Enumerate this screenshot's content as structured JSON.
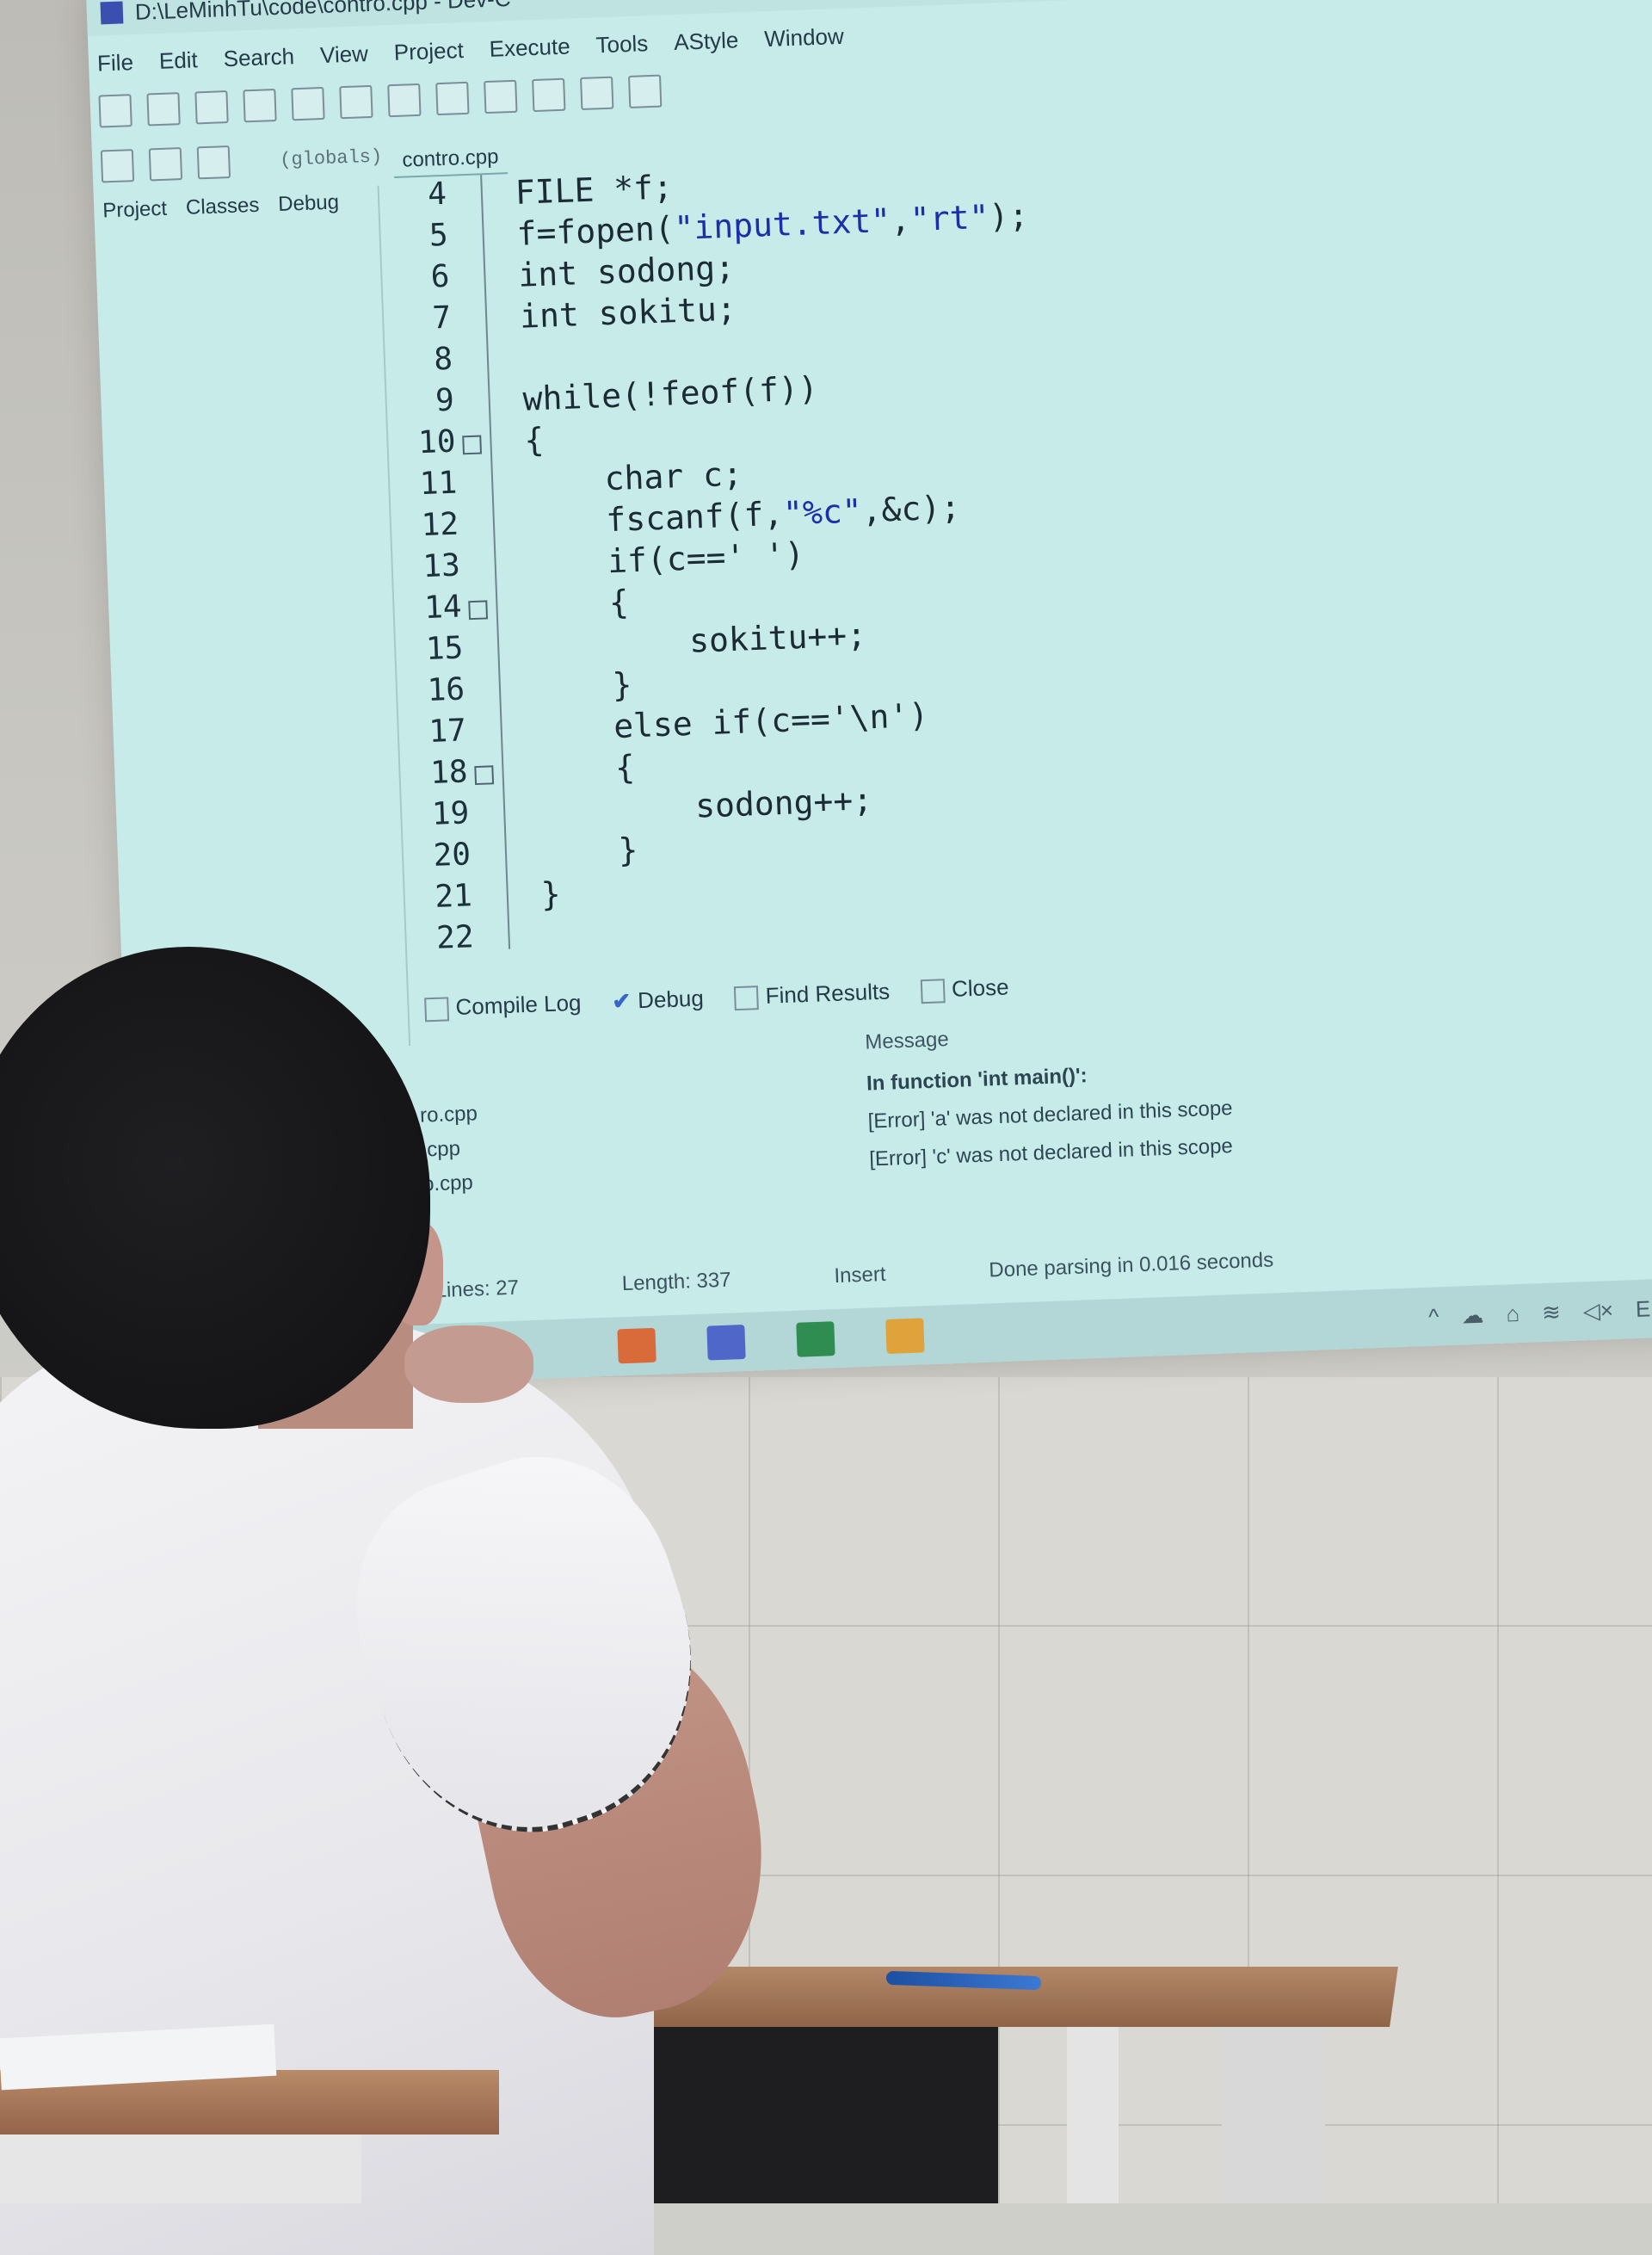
{
  "window": {
    "title": "D:\\LeMinhTu\\code\\contro.cpp - Dev-C"
  },
  "menu": [
    "File",
    "Edit",
    "Search",
    "View",
    "Project",
    "Execute",
    "Tools",
    "AStyle",
    "Window"
  ],
  "toolbar": {
    "globals": "(globals)"
  },
  "left_tabs": [
    "Project",
    "Classes",
    "Debug"
  ],
  "file_tab": "contro.cpp",
  "code_lines": [
    {
      "n": "4",
      "text": "FILE *f;"
    },
    {
      "n": "5",
      "text": "f=fopen(\"input.txt\",\"rt\");"
    },
    {
      "n": "6",
      "text": "int sodong;"
    },
    {
      "n": "7",
      "text": "int sokitu;"
    },
    {
      "n": "8",
      "text": ""
    },
    {
      "n": "9",
      "text": "while(!feof(f))"
    },
    {
      "n": "10",
      "text": "{"
    },
    {
      "n": "11",
      "text": "    char c;"
    },
    {
      "n": "12",
      "text": "    fscanf(f,\"%c\",&c);"
    },
    {
      "n": "13",
      "text": "    if(c==' ')"
    },
    {
      "n": "14",
      "text": "    {"
    },
    {
      "n": "15",
      "text": "        sokitu++;"
    },
    {
      "n": "16",
      "text": "    }"
    },
    {
      "n": "17",
      "text": "    else if(c=='\\n')"
    },
    {
      "n": "18",
      "text": "    {"
    },
    {
      "n": "19",
      "text": "        sodong++;"
    },
    {
      "n": "20",
      "text": "    }"
    },
    {
      "n": "21",
      "text": "}"
    },
    {
      "n": "22",
      "text": ""
    }
  ],
  "bottom_tabs": {
    "compile_log": "Compile Log",
    "debug": "Debug",
    "find_results": "Find Results",
    "close": "Close"
  },
  "messages": {
    "header": "Message",
    "files": [
      "ro.cpp",
      ".cpp",
      "o.cpp"
    ],
    "lines": [
      "In function 'int main()':",
      "[Error] 'a' was not declared in this scope",
      "[Error] 'c' was not declared in this scope"
    ]
  },
  "status": {
    "lines": "Lines: 27",
    "length": "Length: 337",
    "mode": "Insert",
    "parse": "Done parsing in 0.016 seconds"
  },
  "tray": {
    "lang": "ENG"
  },
  "colors": {
    "screen_bg": "#c6ebe9",
    "string": "#1d2fa8",
    "shirt": "#f4f4f6",
    "desk": "#b28868"
  }
}
